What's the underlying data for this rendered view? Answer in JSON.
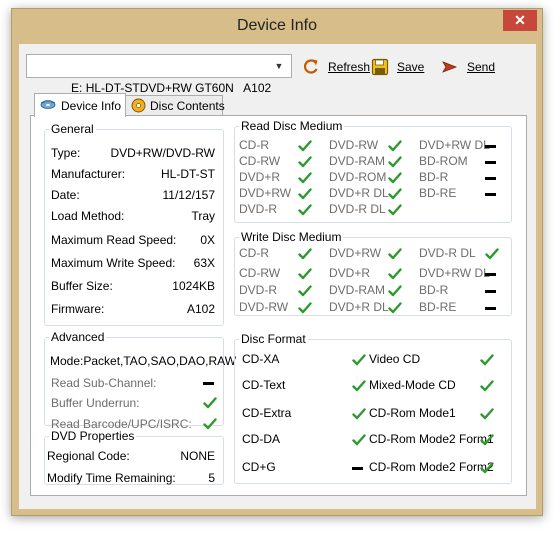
{
  "window": {
    "title": "Device Info",
    "close_glyph": "✕"
  },
  "toolbar": {
    "device_value": "E: HL-DT-STDVD+RW GT60N   A102",
    "refresh_label": "Refresh",
    "save_label": "Save",
    "send_label": "Send"
  },
  "tabs": [
    {
      "label": "Device Info",
      "icon": "disc-drive-icon",
      "active": true
    },
    {
      "label": "Disc Contents",
      "icon": "disc-icon",
      "active": false
    }
  ],
  "general": {
    "legend": "General",
    "rows": [
      {
        "label": "Type:",
        "value": "DVD+RW/DVD-RW"
      },
      {
        "label": "Manufacturer:",
        "value": "HL-DT-ST"
      },
      {
        "label": "Date:",
        "value": "11/12/157"
      },
      {
        "label": "Load Method:",
        "value": "Tray"
      },
      {
        "label": "Maximum Read Speed:",
        "value": "0X"
      },
      {
        "label": "Maximum Write Speed:",
        "value": "63X"
      },
      {
        "label": "Buffer Size:",
        "value": "1024KB"
      },
      {
        "label": "Firmware:",
        "value": "A102"
      }
    ]
  },
  "advanced": {
    "legend": "Advanced",
    "mode": "Mode:Packet,TAO,SAO,DAO,RAW",
    "rows": [
      {
        "label": "Read Sub-Channel:",
        "status": "no"
      },
      {
        "label": "Buffer Underrun:",
        "status": "yes"
      },
      {
        "label": "Read Barcode/UPC/ISRC:",
        "status": "yes"
      }
    ]
  },
  "dvd_properties": {
    "legend": "DVD Properties",
    "rows": [
      {
        "label": "Regional Code:",
        "value": "NONE"
      },
      {
        "label": "Modify Time Remaining:",
        "value": "5"
      }
    ]
  },
  "read_disc_medium": {
    "legend": "Read Disc Medium",
    "items": [
      {
        "label": "CD-R",
        "status": "yes"
      },
      {
        "label": "DVD-RW",
        "status": "yes"
      },
      {
        "label": "DVD+RW DL",
        "status": "no"
      },
      {
        "label": "CD-RW",
        "status": "yes"
      },
      {
        "label": "DVD-RAM",
        "status": "yes"
      },
      {
        "label": "BD-ROM",
        "status": "no"
      },
      {
        "label": "DVD+R",
        "status": "yes"
      },
      {
        "label": "DVD-ROM",
        "status": "yes"
      },
      {
        "label": "BD-R",
        "status": "no"
      },
      {
        "label": "DVD+RW",
        "status": "yes"
      },
      {
        "label": "DVD+R DL",
        "status": "yes"
      },
      {
        "label": "BD-RE",
        "status": "no"
      },
      {
        "label": "DVD-R",
        "status": "yes"
      },
      {
        "label": "DVD-R DL",
        "status": "yes"
      }
    ]
  },
  "write_disc_medium": {
    "legend": "Write Disc Medium",
    "items": [
      {
        "label": "CD-R",
        "status": "yes"
      },
      {
        "label": "DVD+RW",
        "status": "yes"
      },
      {
        "label": "DVD-R DL",
        "status": "yes"
      },
      {
        "label": "CD-RW",
        "status": "yes"
      },
      {
        "label": "DVD+R",
        "status": "yes"
      },
      {
        "label": "DVD+RW DL",
        "status": "no"
      },
      {
        "label": "DVD-R",
        "status": "yes"
      },
      {
        "label": "DVD-RAM",
        "status": "yes"
      },
      {
        "label": "BD-R",
        "status": "no"
      },
      {
        "label": "DVD-RW",
        "status": "yes"
      },
      {
        "label": "DVD+R DL",
        "status": "yes"
      },
      {
        "label": "BD-RE",
        "status": "no"
      }
    ]
  },
  "disc_format": {
    "legend": "Disc Format",
    "items": [
      {
        "label": "CD-XA",
        "status": "yes"
      },
      {
        "label": "Video CD",
        "status": "yes"
      },
      {
        "label": "CD-Text",
        "status": "yes"
      },
      {
        "label": "Mixed-Mode CD",
        "status": "yes"
      },
      {
        "label": "CD-Extra",
        "status": "yes"
      },
      {
        "label": "CD-Rom Mode1",
        "status": "yes"
      },
      {
        "label": "CD-DA",
        "status": "yes"
      },
      {
        "label": "CD-Rom Mode2 Form1",
        "status": "yes"
      },
      {
        "label": "CD+G",
        "status": "no"
      },
      {
        "label": "CD-Rom Mode2 Form2",
        "status": "yes"
      }
    ]
  },
  "colors": {
    "check": "#2e9a2e",
    "frame": "#d6bd89",
    "close": "#c7483b"
  }
}
